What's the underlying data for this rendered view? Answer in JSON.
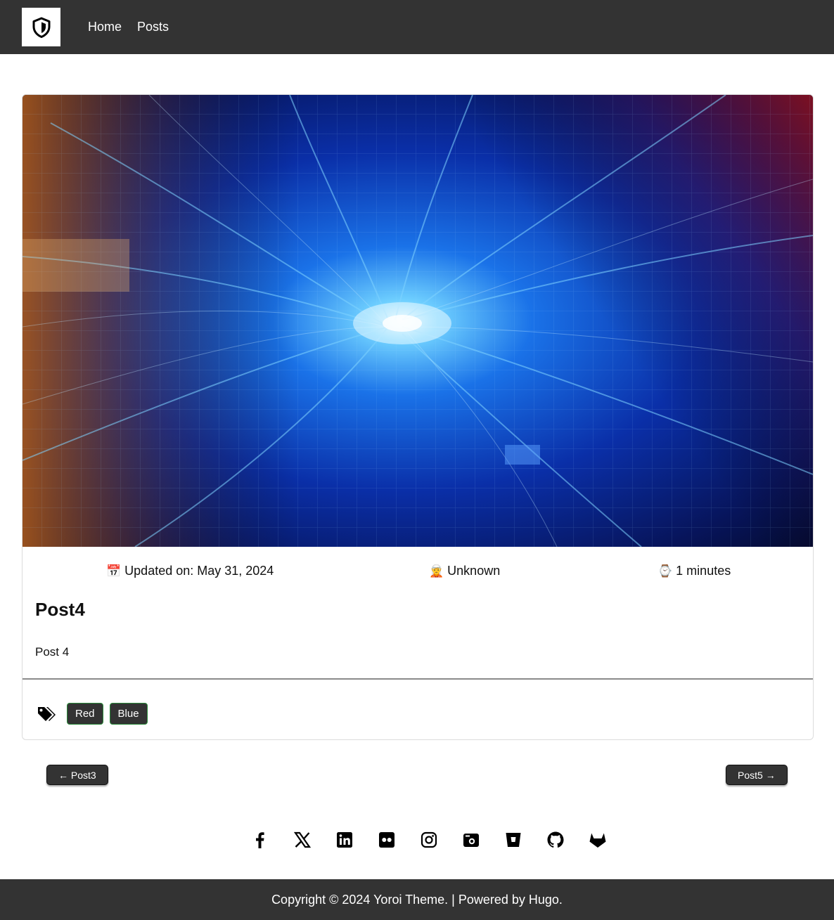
{
  "navbar": {
    "logo_icon": "shield-icon",
    "links": [
      {
        "label": "Home"
      },
      {
        "label": "Posts"
      }
    ]
  },
  "post": {
    "hero_image": "abstract-blue-light-streaks-image",
    "meta": {
      "date_icon": "📅",
      "date_text": "Updated on: May 31, 2024",
      "author_icon": "🧝",
      "author_text": "Unknown",
      "time_icon": "⌚",
      "time_text": "1 minutes"
    },
    "title": "Post4",
    "body": "Post 4",
    "tags_icon": "tags-icon",
    "tags": [
      "Red",
      "Blue"
    ]
  },
  "pagination": {
    "prev_label": "← Post3",
    "next_label": "Post5 →"
  },
  "socials": [
    "facebook-icon",
    "x-icon",
    "linkedin-icon",
    "flickr-icon",
    "instagram-icon",
    "camera-icon",
    "bitbucket-icon",
    "github-icon",
    "gitlab-icon"
  ],
  "footer": {
    "text": "Copyright © 2024 Yoroi Theme. | Powered by Hugo."
  },
  "colors": {
    "navbar": "#333333",
    "tag_border": "#2a8a3a"
  }
}
